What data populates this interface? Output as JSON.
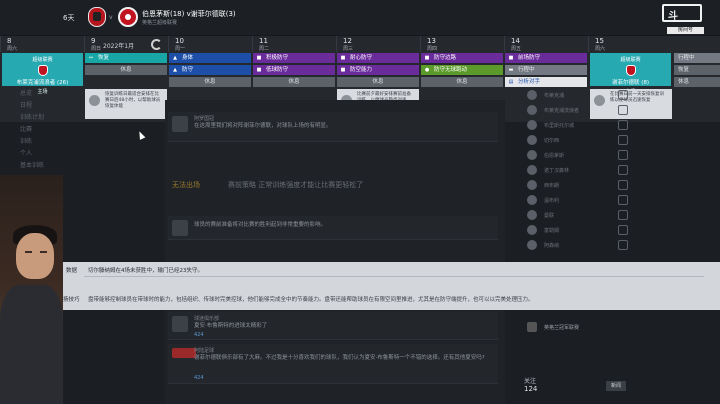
{
  "header": {
    "days_left": "6天",
    "vs": "v",
    "match_title": "伯恩茅斯(18) v谢菲尔德联(3)",
    "match_subtitle": "英格兰超级联赛"
  },
  "stream": {
    "logo_text": "斗",
    "room_label": "房间号",
    "room_number": "4447018"
  },
  "calendar": {
    "month_label": "2022年1月",
    "days": [
      {
        "num": "8",
        "weekday": "周六"
      },
      {
        "num": "9",
        "weekday": "周日"
      },
      {
        "num": "10",
        "weekday": "周一"
      },
      {
        "num": "11",
        "weekday": "周二"
      },
      {
        "num": "12",
        "weekday": "周三"
      },
      {
        "num": "13",
        "weekday": "周四"
      },
      {
        "num": "14",
        "weekday": "周五"
      },
      {
        "num": "15",
        "weekday": "周六"
      }
    ],
    "match_left": {
      "label": "超级联赛",
      "team": "布莱克浦流浪者 (26)",
      "venue": "主场"
    },
    "match_right": {
      "label": "超级联赛",
      "team": "谢菲尔德联 (8)",
      "venue": "客场"
    },
    "sessions": {
      "d9_1": "恢复",
      "d9_2": "休息",
      "d10_1": "身体",
      "d10_2": "防守",
      "d10_3": "休息",
      "d11_1": "积极防守",
      "d11_2": "低球防守",
      "d11_3": "休息",
      "d12_1": "耐心防守",
      "d12_2": "防空能力",
      "d12_3": "休息",
      "d13_1": "防守边路",
      "d13_2": "防守无球跑动",
      "d13_3": "休息",
      "d14_1": "前场防守",
      "d14_2": "行程中",
      "d14_3": "分析对手",
      "d16_1": "行程中",
      "d16_2": "恢复",
      "d16_3": "休息"
    },
    "notes": {
      "n1": "恢复训练日最适合安排在比赛日后48小时，以帮助球员恢复体能",
      "n2": "比赛前夕最好安排赛前准备训练，以便球员熟悉对手",
      "n3": "在比赛日前一天安排恢复训练以便球员迅速恢复"
    }
  },
  "leftnav": [
    "总览",
    "日程",
    "训练计划",
    "比赛",
    "训练",
    "个人",
    "基本训练"
  ],
  "feed": {
    "ghost_1": "赛前策略 正常训练强度才能让比赛更轻松了",
    "ghost_orange": "无法出场",
    "post_1_name": "阿罗国冠",
    "post_1_body": "在这周里我们将对阵谢菲尔德联，对球队上场的有明显。",
    "post_2_body": "球员的赛前准备将对比赛的胜利起到非常重要的影响。",
    "post_3_name": "球迷俱乐部",
    "post_3_body": "夏安·布鲁斯特的进球太精彩了",
    "post_4_name": "阿陆足球",
    "post_4_body": "谢菲尔德联俱乐部有了大麻。不过我是十分喜欢我们的球队，我们认为夏安·布鲁斯特一个不错的选择。还有其他夏安吗?",
    "post_4_likes": "424",
    "post_3_likes": "424"
  },
  "rightlist": [
    "布莱克浦",
    "布莱克浦流浪者",
    "布里斯托尔城",
    "切尔西",
    "伯恩茅斯",
    "诺丁汉森林",
    "西布朗",
    "温布利",
    "曼联",
    "富勒姆",
    "阿森纳"
  ],
  "trophy_text": "英格兰冠军联赛",
  "follow": {
    "label": "关注",
    "count": "124",
    "button": "新闻"
  },
  "tooltip": {
    "label_1": "数据",
    "text_1": "切尔滕纳姆在4场未获胜中，输门已经23失守。",
    "label_2": "扬技巧",
    "text_2": "盘带能够控制球员在带球时的能力，包括组织、传球时完美控球，他们能够完成全中的节奏能力。盘带还能帮助球员在有限空间里推进，尤其是在防守端提升，也可以以完美处理压力。"
  }
}
